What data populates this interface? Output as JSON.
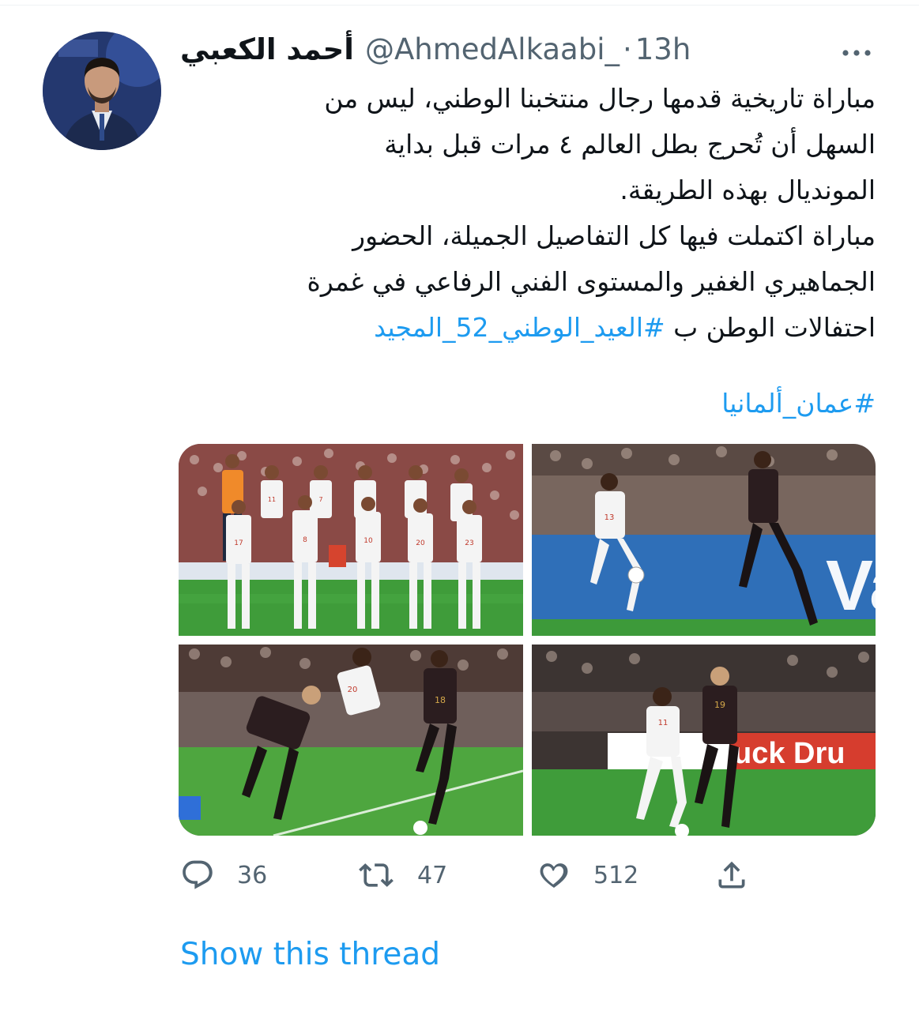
{
  "tweet": {
    "display_name": "أحمد الكعبي",
    "handle": "@AhmedAlkaabi_",
    "separator": "·",
    "time": "13h",
    "lines": [
      "مباراة تاريخية قدمها رجال منتخبنا الوطني، ليس من",
      "السهل أن تُحرج بطل العالم ٤ مرات قبل بداية",
      "المونديال بهذه الطريقة.",
      "مباراة اكتملت فيها كل التفاصيل الجميلة، الحضور",
      "الجماهيري الغفير والمستوى الفني الرفاعي في غمرة"
    ],
    "last_line_text": "احتفالات الوطن ب ",
    "hashtag_1": "#العيد_الوطني_52_المجيد",
    "hashtag_2": "#عمان_ألمانيا"
  },
  "media": {
    "photos": [
      {
        "name": "oman-team-lineup-photo",
        "shirt_numbers": [
          "11",
          "7",
          "17",
          "8",
          "10",
          "20",
          "23"
        ]
      },
      {
        "name": "oman-vs-germany-action-photo-1",
        "shirt_numbers": [
          "13"
        ]
      },
      {
        "name": "oman-vs-germany-action-photo-2",
        "shirt_numbers": [
          "20",
          "18"
        ]
      },
      {
        "name": "oman-vs-germany-action-photo-3",
        "shirt_numbers": [
          "11",
          "19"
        ]
      }
    ]
  },
  "actions": {
    "reply_count": "36",
    "retweet_count": "47",
    "like_count": "512"
  },
  "show_thread_label": "Show this thread",
  "icons": [
    "more-icon",
    "reply-icon",
    "retweet-icon",
    "like-icon",
    "share-icon"
  ],
  "colors": {
    "link": "#1d9bf0",
    "secondary_text": "#536471",
    "primary_text": "#0f1419",
    "oman_kit": "#f4f4f4",
    "germany_kit": "#2b1d1f",
    "pitch": "#3f9c3a"
  }
}
